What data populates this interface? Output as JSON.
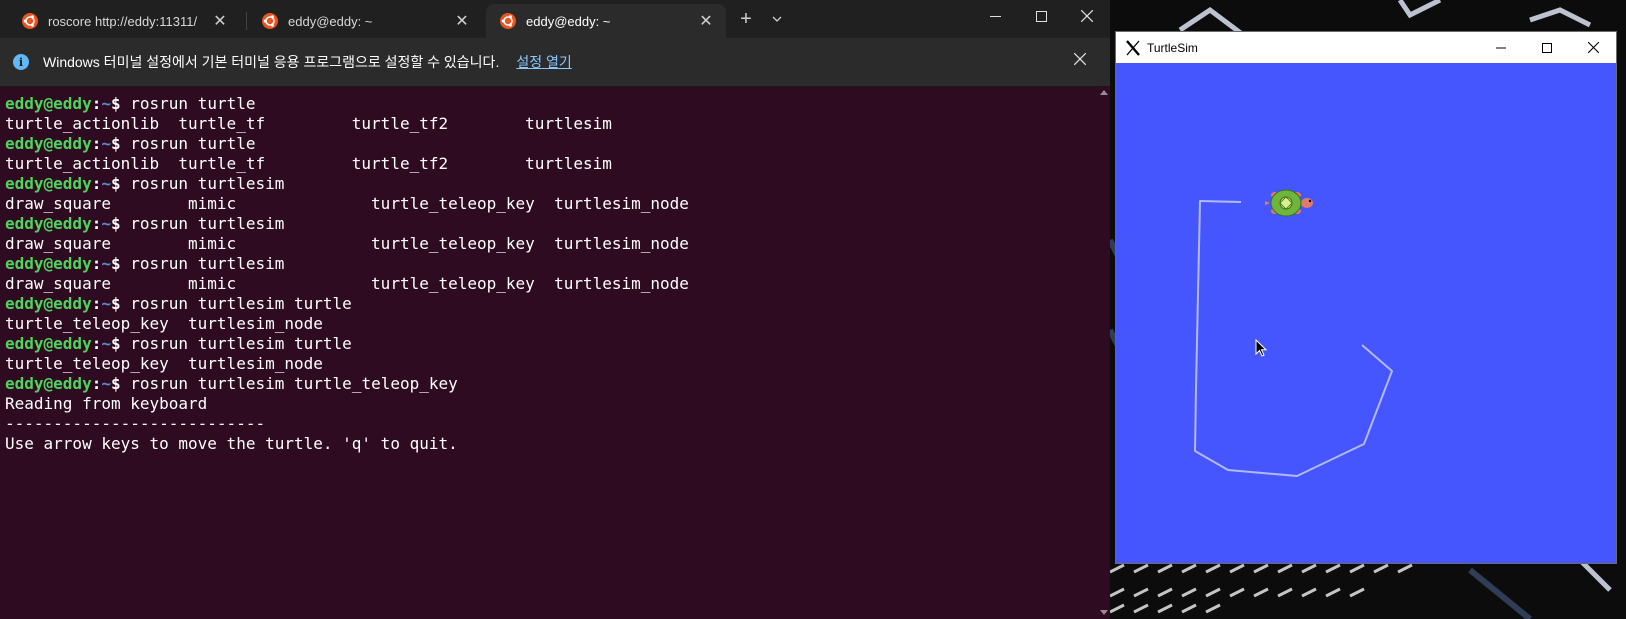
{
  "terminal": {
    "tabs": [
      {
        "title": "roscore http://eddy:11311/",
        "active": false
      },
      {
        "title": "eddy@eddy: ~",
        "active": false
      },
      {
        "title": "eddy@eddy: ~",
        "active": true
      }
    ],
    "new_tab_icon": "plus-icon",
    "dropdown_icon": "chevron-down-icon",
    "infobar": {
      "message": "Windows 터미널 설정에서 기본 터미널 응용 프로그램으로 설정할 수 있습니다.",
      "link": "설정 열기",
      "info_glyph": "i"
    },
    "prompt": {
      "user": "eddy@eddy",
      "colon": ":",
      "path": "~",
      "dollar": "$"
    },
    "lines": [
      {
        "type": "cmd",
        "text": " rosrun turtle"
      },
      {
        "type": "out",
        "text": "turtle_actionlib  turtle_tf         turtle_tf2        turtlesim"
      },
      {
        "type": "cmd",
        "text": " rosrun turtle"
      },
      {
        "type": "out",
        "text": "turtle_actionlib  turtle_tf         turtle_tf2        turtlesim"
      },
      {
        "type": "cmd",
        "text": " rosrun turtlesim"
      },
      {
        "type": "out",
        "text": "draw_square        mimic              turtle_teleop_key  turtlesim_node"
      },
      {
        "type": "cmd",
        "text": " rosrun turtlesim"
      },
      {
        "type": "out",
        "text": "draw_square        mimic              turtle_teleop_key  turtlesim_node"
      },
      {
        "type": "cmd",
        "text": " rosrun turtlesim"
      },
      {
        "type": "out",
        "text": "draw_square        mimic              turtle_teleop_key  turtlesim_node"
      },
      {
        "type": "cmd",
        "text": " rosrun turtlesim turtle"
      },
      {
        "type": "out",
        "text": "turtle_teleop_key  turtlesim_node"
      },
      {
        "type": "cmd",
        "text": " rosrun turtlesim turtle"
      },
      {
        "type": "out",
        "text": "turtle_teleop_key  turtlesim_node"
      },
      {
        "type": "cmd",
        "text": " rosrun turtlesim turtle_teleop_key"
      },
      {
        "type": "out",
        "text": "Reading from keyboard"
      },
      {
        "type": "out",
        "text": "---------------------------"
      },
      {
        "type": "out",
        "text": "Use arrow keys to move the turtle. 'q' to quit."
      }
    ]
  },
  "turtlesim": {
    "title": "TurtleSim",
    "background": "#4556ff",
    "pen_color": "#b3b8ff"
  },
  "colors": {
    "terminal_bg": "#2f0b21",
    "prompt_user": "#4cd55b",
    "prompt_path": "#4f8fd8"
  }
}
